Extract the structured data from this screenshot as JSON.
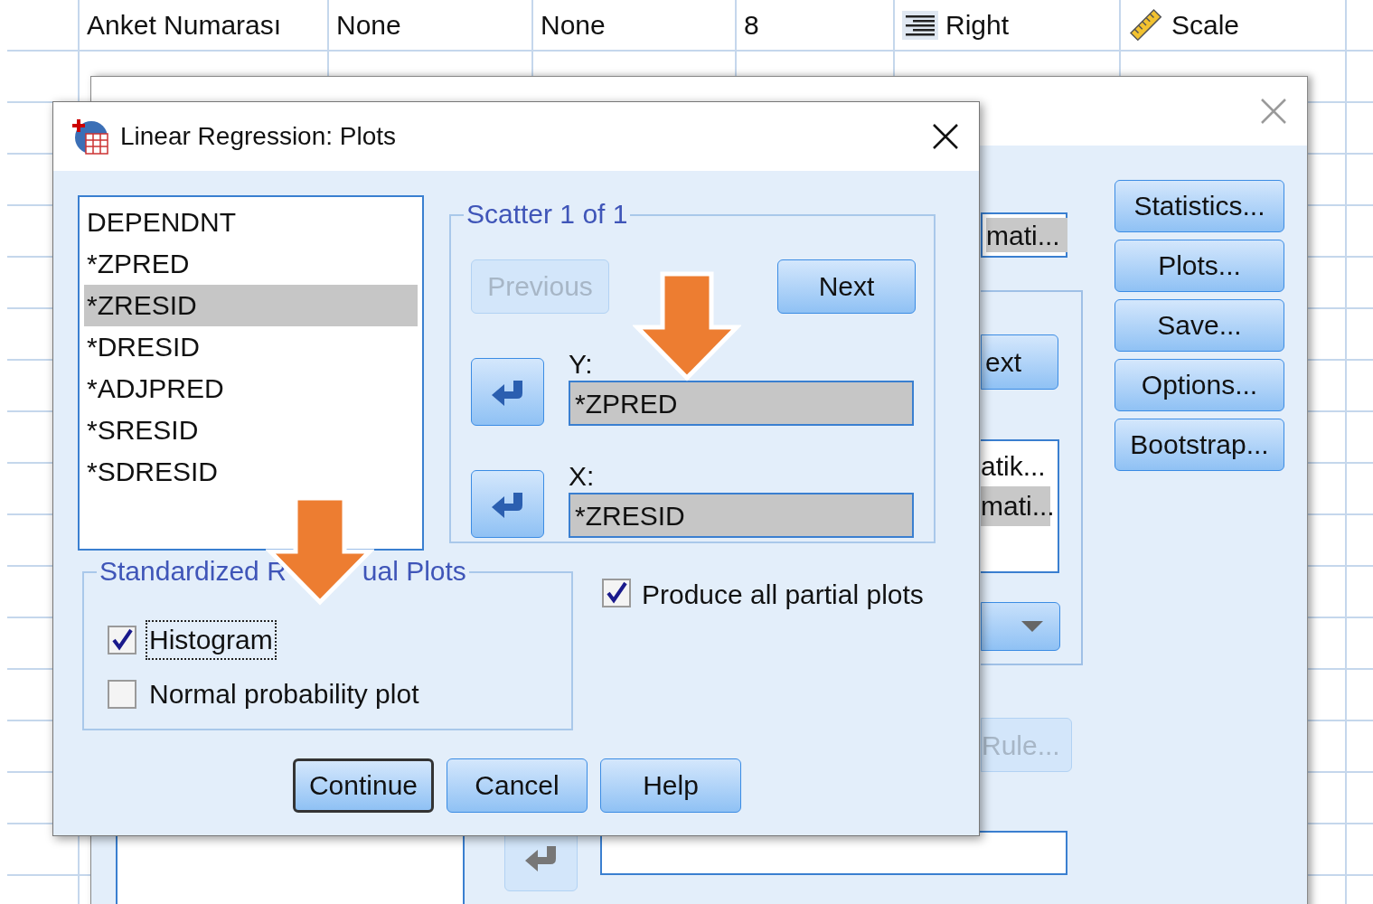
{
  "spreadsheet": {
    "rows": [
      {
        "cells": [
          {
            "kind": "text",
            "text": "Anket Numarası"
          },
          {
            "kind": "text",
            "text": "None"
          },
          {
            "kind": "text",
            "text": "None"
          },
          {
            "kind": "text",
            "text": "8"
          },
          {
            "kind": "align",
            "text": "Right"
          },
          {
            "kind": "measure",
            "text": "Scale"
          }
        ]
      }
    ]
  },
  "back_dialog": {
    "buttons": [
      {
        "label": "Statistics..."
      },
      {
        "label": "Plots..."
      },
      {
        "label": "Save..."
      },
      {
        "label": "Options..."
      },
      {
        "label": "Bootstrap..."
      }
    ],
    "field_value": "mati...",
    "button_fragment": "ext",
    "list_items": [
      {
        "text": "atik...",
        "selected": false
      },
      {
        "text": "mati...",
        "selected": true
      }
    ],
    "rule_button": {
      "label": "Rule...",
      "disabled": true
    }
  },
  "dialog": {
    "title": "Linear Regression: Plots",
    "source_list": [
      {
        "text": "DEPENDNT",
        "selected": false
      },
      {
        "text": "*ZPRED",
        "selected": false
      },
      {
        "text": "*ZRESID",
        "selected": true
      },
      {
        "text": "*DRESID",
        "selected": false
      },
      {
        "text": "*ADJPRED",
        "selected": false
      },
      {
        "text": "*SRESID",
        "selected": false
      },
      {
        "text": "*SDRESID",
        "selected": false
      }
    ],
    "scatter": {
      "legend": "Scatter 1 of 1",
      "previous": {
        "label": "Previous",
        "disabled": true
      },
      "next": {
        "label": "Next",
        "disabled": false
      },
      "fields": [
        {
          "label": "Y:",
          "value": "*ZPRED"
        },
        {
          "label": "X:",
          "value": "*ZRESID"
        }
      ]
    },
    "residual_group": {
      "legend_parts": [
        "Standardized R",
        "ual Plots"
      ],
      "checkboxes": [
        {
          "label": "Histogram",
          "checked": true,
          "focused": true
        },
        {
          "label": "Normal probability plot",
          "checked": false,
          "focused": false
        }
      ]
    },
    "partial_plots": {
      "label": "Produce all partial plots",
      "checked": true
    },
    "buttons": [
      {
        "label": "Continue",
        "default": true
      },
      {
        "label": "Cancel",
        "default": false
      },
      {
        "label": "Help",
        "default": false
      }
    ]
  }
}
